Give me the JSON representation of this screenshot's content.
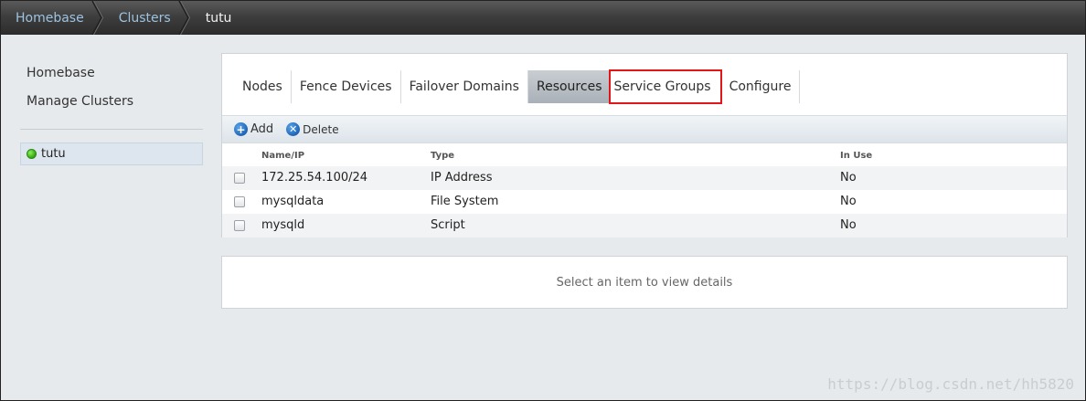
{
  "breadcrumb": {
    "items": [
      {
        "label": "Homebase"
      },
      {
        "label": "Clusters"
      }
    ],
    "current": "tutu"
  },
  "sidebar": {
    "links": [
      {
        "label": "Homebase"
      },
      {
        "label": "Manage Clusters"
      }
    ],
    "clusters": [
      {
        "label": "tutu",
        "status": "online",
        "status_color": "#2ea60f"
      }
    ]
  },
  "tabs": [
    {
      "label": "Nodes"
    },
    {
      "label": "Fence Devices"
    },
    {
      "label": "Failover Domains"
    },
    {
      "label": "Resources",
      "active": true
    },
    {
      "label": "Service Groups",
      "highlighted": true
    },
    {
      "label": "Configure"
    }
  ],
  "toolbar": {
    "add_label": "Add",
    "add_icon": "plus-circle-icon",
    "delete_label": "Delete",
    "delete_icon": "x-circle-icon"
  },
  "table": {
    "columns": [
      "Name/IP",
      "Type",
      "In Use"
    ],
    "rows": [
      {
        "name": "172.25.54.100/24",
        "type": "IP Address",
        "in_use": "No"
      },
      {
        "name": "mysqldata",
        "type": "File System",
        "in_use": "No"
      },
      {
        "name": "mysqld",
        "type": "Script",
        "in_use": "No"
      }
    ]
  },
  "details": {
    "placeholder": "Select an item to view details"
  },
  "watermark": "https://blog.csdn.net/hh5820",
  "colors": {
    "highlight_box": "#e0161a",
    "link": "#9ec3e0",
    "active_tab": "#a9b0b7"
  }
}
